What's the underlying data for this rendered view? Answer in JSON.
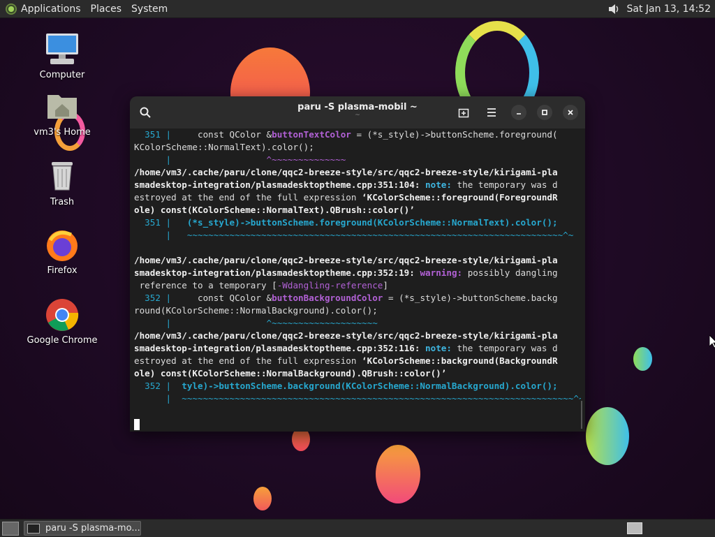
{
  "top_panel": {
    "menus": [
      "Applications",
      "Places",
      "System"
    ],
    "clock": "Sat Jan 13, 14:52"
  },
  "desktop": {
    "icons": [
      {
        "label": "Computer",
        "icon": "computer-icon"
      },
      {
        "label": "vm3's Home",
        "icon": "home-folder-icon"
      },
      {
        "label": "Trash",
        "icon": "trash-icon"
      },
      {
        "label": "Firefox",
        "icon": "firefox-icon"
      },
      {
        "label": "Google Chrome",
        "icon": "chrome-icon"
      }
    ]
  },
  "terminal": {
    "title": "paru -S plasma-mobil ~",
    "subtitle": "~",
    "lines": [
      "  351 |     const QColor &buttonTextColor = (*s_style)->buttonScheme.foreground(",
      "KColorScheme::NormalText).color();",
      "      |                  ^~~~~~~~~~~~~~~",
      "/home/vm3/.cache/paru/clone/qqc2-breeze-style/src/qqc2-breeze-style/kirigami-pla",
      "smadesktop-integration/plasmadesktoptheme.cpp:351:104: note: the temporary was d",
      "estroyed at the end of the full expression ‘KColorScheme::foreground(ForegroundR",
      "ole) const(KColorScheme::NormalText).QBrush::color()’",
      "  351 |   (*s_style)->buttonScheme.foreground(KColorScheme::NormalText).color();",
      "      |   ~~~~~~~~~~~~~~~~~~~~~~~~~~~~~~~~~~~~~~~~~~~~~~~~~~~~~~~~~~~~~~~~~~~~~~~^~",
      "",
      "/home/vm3/.cache/paru/clone/qqc2-breeze-style/src/qqc2-breeze-style/kirigami-pla",
      "smadesktop-integration/plasmadesktoptheme.cpp:352:19: warning: possibly dangling",
      " reference to a temporary [-Wdangling-reference]",
      "  352 |     const QColor &buttonBackgroundColor = (*s_style)->buttonScheme.backg",
      "round(KColorScheme::NormalBackground).color();",
      "      |                  ^~~~~~~~~~~~~~~~~~~~~",
      "/home/vm3/.cache/paru/clone/qqc2-breeze-style/src/qqc2-breeze-style/kirigami-pla",
      "smadesktop-integration/plasmadesktoptheme.cpp:352:116: note: the temporary was d",
      "estroyed at the end of the full expression ‘KColorScheme::background(BackgroundR",
      "ole) const(KColorScheme::NormalBackground).QBrush::color()’",
      "  352 |  tyle)->buttonScheme.background(KColorScheme::NormalBackground).color();",
      "      |  ~~~~~~~~~~~~~~~~~~~~~~~~~~~~~~~~~~~~~~~~~~~~~~~~~~~~~~~~~~~~~~~~~~~~~~~~~~^~"
    ]
  },
  "bottom_panel": {
    "task_label": "paru -S plasma-mo..."
  },
  "colors": {
    "note": "#3fb6e0",
    "warning": "#b261d6",
    "highlight": "#b261d6",
    "code_cyan": "#27a8cf"
  }
}
